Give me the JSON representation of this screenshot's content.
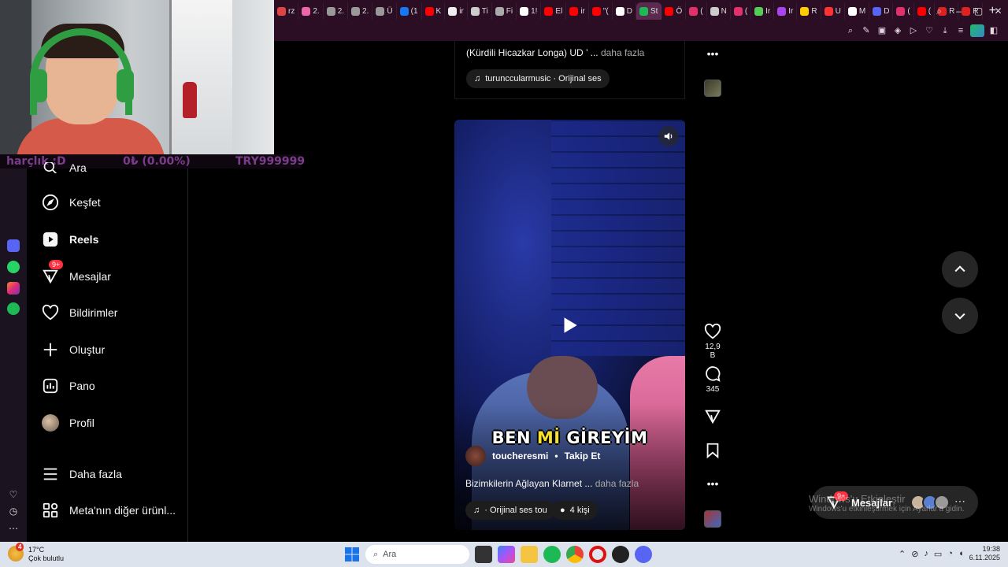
{
  "browser": {
    "tabs": [
      {
        "label": "rz",
        "color": "#d44"
      },
      {
        "label": "2.",
        "color": "#e6a"
      },
      {
        "label": "2.",
        "color": "#999"
      },
      {
        "label": "2.",
        "color": "#999"
      },
      {
        "label": "Ü",
        "color": "#999"
      },
      {
        "label": "(1",
        "color": "#1877f2"
      },
      {
        "label": "K",
        "color": "#f00"
      },
      {
        "label": "ir",
        "color": "#eee"
      },
      {
        "label": "Ti",
        "color": "#ccc"
      },
      {
        "label": "Fi",
        "color": "#aaa"
      },
      {
        "label": "1!",
        "color": "#fff"
      },
      {
        "label": "El",
        "color": "#f00"
      },
      {
        "label": "ir",
        "color": "#f00"
      },
      {
        "label": "\"(",
        "color": "#f00"
      },
      {
        "label": "D",
        "color": "#fff"
      },
      {
        "label": "St",
        "color": "#1db954"
      },
      {
        "label": "Ö",
        "color": "#f00"
      },
      {
        "label": "(",
        "color": "#e1306c"
      },
      {
        "label": "N",
        "color": "#ccc"
      },
      {
        "label": "(",
        "color": "#e1306c"
      },
      {
        "label": "Ir",
        "color": "#5c5"
      },
      {
        "label": "Ir",
        "color": "#a4e"
      },
      {
        "label": "R",
        "color": "#fc0"
      },
      {
        "label": "U",
        "color": "#f33"
      },
      {
        "label": "M",
        "color": "#fff"
      },
      {
        "label": "D",
        "color": "#5865f2"
      },
      {
        "label": "(",
        "color": "#e1306c"
      },
      {
        "label": "(",
        "color": "#f00"
      },
      {
        "label": "R",
        "color": "#d22"
      },
      {
        "label": "R",
        "color": "#d22"
      }
    ]
  },
  "stream": {
    "ticker_left": "harçlık :D",
    "ticker_mid": "0₺ (0.00%)",
    "ticker_right": "TRY999999"
  },
  "nav": {
    "search_label": "Ara",
    "items": [
      {
        "label": "Keşfet",
        "icon": "compass-icon"
      },
      {
        "label": "Reels",
        "icon": "reels-icon"
      },
      {
        "label": "Mesajlar",
        "icon": "messenger-icon",
        "badge": "9+"
      },
      {
        "label": "Bildirimler",
        "icon": "heart-icon"
      },
      {
        "label": "Oluştur",
        "icon": "plus-icon"
      },
      {
        "label": "Pano",
        "icon": "dashboard-icon"
      },
      {
        "label": "Profil",
        "icon": "avatar"
      },
      {
        "label": "Daha fazla",
        "icon": "menu-icon"
      },
      {
        "label": "Meta'nın diğer ürünl...",
        "icon": "apps-icon"
      }
    ]
  },
  "feed": {
    "prev_post": {
      "caption": "(Kürdili Hicazkar Longa) UD ’ ...",
      "more": " daha fazla",
      "audio": "turunccularmusic · Orijinal ses"
    },
    "post": {
      "overlay_text_1": "BEN ",
      "overlay_text_hl": "Mİ",
      "overlay_text_2": " GİREYİM",
      "username": "toucheresmi",
      "follow": "Takip Et",
      "separator": "•",
      "caption": "Bizimkilerin Ağlayan Klarnet ...",
      "more": " daha fazla",
      "audio": "· Orijinal ses   tou",
      "people": "4 kişi",
      "likes": "12,9 B",
      "comments": "345"
    }
  },
  "messages_popup": {
    "label": "Mesajlar",
    "badge": "9+"
  },
  "watermark": {
    "title": "Windows'u Etkinleştir",
    "subtitle": "Windows'u etkinleştirmek için Ayarlar'a gidin."
  },
  "taskbar": {
    "temp": "17°C",
    "weather": "Çok bulutlu",
    "weather_badge": "4",
    "search_placeholder": "Ara",
    "time": "19:38",
    "date": "6.11.2025"
  }
}
